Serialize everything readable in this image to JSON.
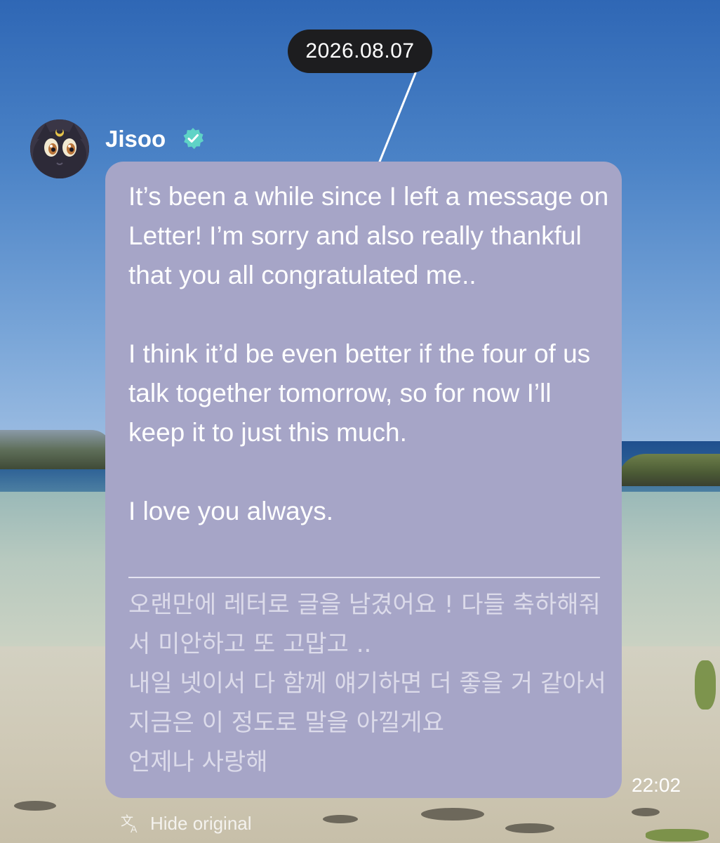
{
  "conversation": {
    "date": "2026.08.07"
  },
  "sender": {
    "name": "Jisoo",
    "verified": true,
    "verified_icon": "verified-check-icon",
    "avatar_icon": "black-cat-avatar"
  },
  "message": {
    "translated_paragraphs": [
      "It’s been a while since I left a message on Letter! I’m sorry and also really thankful that you all congratulated me..",
      "I think it’d be even better if the four of us talk together tomorrow, so for now I’ll keep it to just this much.",
      "I love you always."
    ],
    "original_lines": [
      "오랜만에 레터로 글을 남겼어요 ! 다들 축하해줘서 미안하고 또 고맙고 ..",
      "내일 넷이서 다 함께 얘기하면 더 좋을 거 같아서 지금은 이 정도로 말을 아낄게요",
      "언제나 사랑해"
    ],
    "time": "22:02"
  },
  "actions": {
    "hide_original_label": "Hide original",
    "translate_icon": "translate-icon"
  },
  "colors": {
    "bubble": "#a6a5c7",
    "date_pill": "#1d1d1f",
    "verified_badge": "#5fd3c6",
    "text_primary": "#ffffff"
  }
}
